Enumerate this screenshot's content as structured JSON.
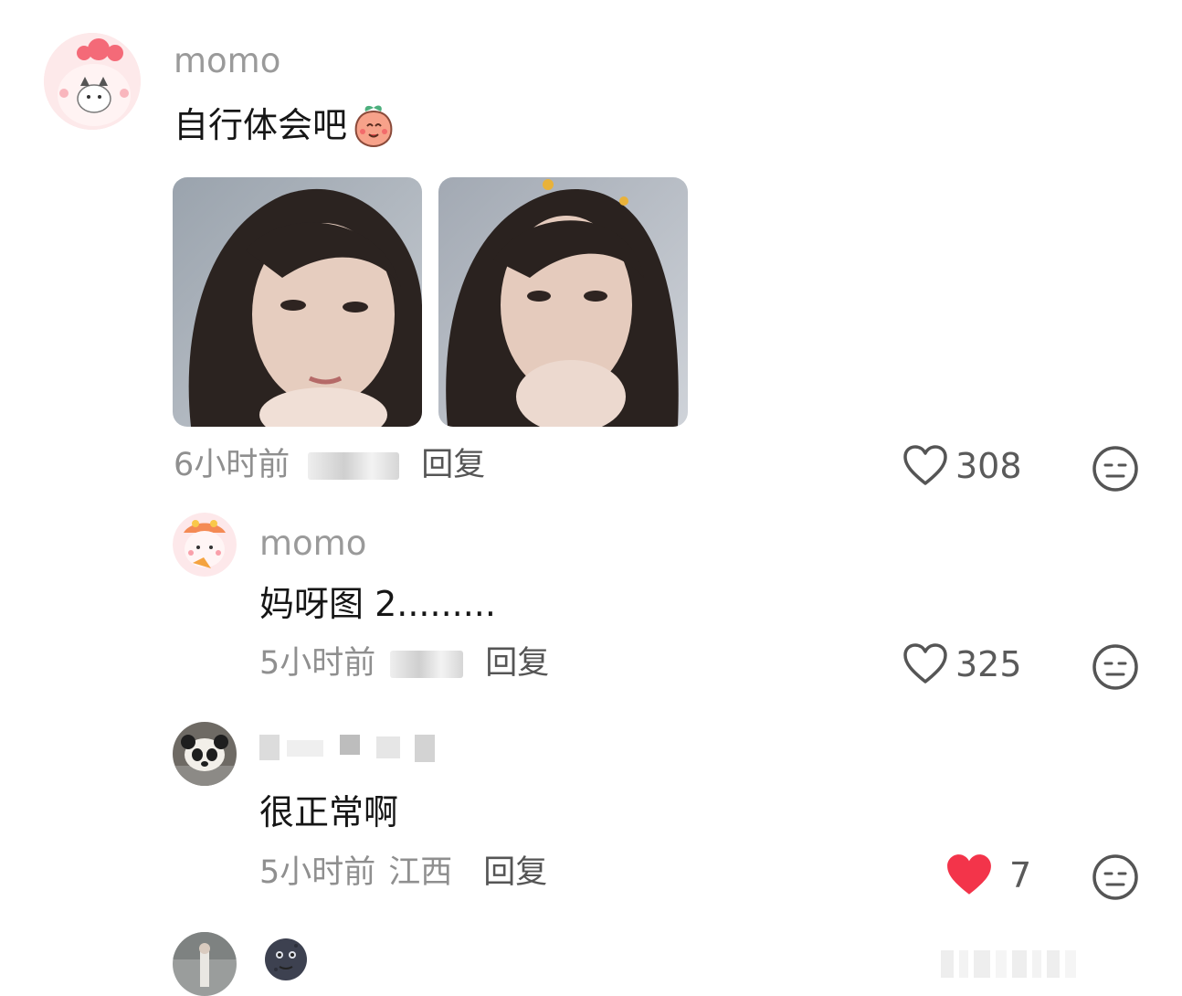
{
  "comments": [
    {
      "username": "momo",
      "text": "自行体会吧",
      "time": "6小时前",
      "reply_label": "回复",
      "like_count": "308",
      "liked": false,
      "photos": [
        "photo-1",
        "photo-2"
      ]
    },
    {
      "username": "momo",
      "text": "妈呀图 2.........",
      "time": "5小时前",
      "reply_label": "回复",
      "like_count": "325",
      "liked": false
    },
    {
      "username": "",
      "text": "很正常啊",
      "time": "5小时前",
      "location": "江西",
      "reply_label": "回复",
      "like_count": "7",
      "liked": true
    }
  ],
  "colors": {
    "liked_heart": "#f3344a",
    "username": "#9a9a9a",
    "meta": "#8f8f8f"
  },
  "icons": {
    "like": "heart-outline-icon",
    "liked": "heart-filled-icon",
    "dislike": "neutral-face-icon"
  }
}
